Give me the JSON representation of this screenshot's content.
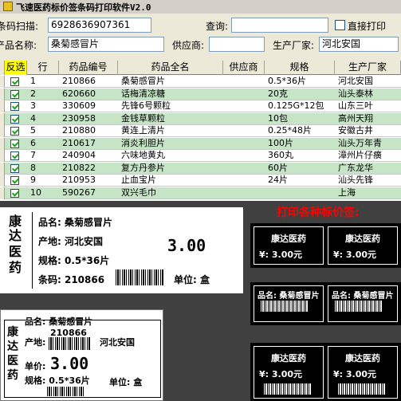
{
  "window": {
    "title": "飞速医药标价签条码打印软件V2.0"
  },
  "form": {
    "barcode_label": "条码扫描:",
    "barcode_value": "6928636907361",
    "query_label": "查询:",
    "query_value": "",
    "print_label": "直接打印",
    "product_label": "产品名称:",
    "product_value": "桑菊感冒片",
    "supplier_label": "供应商:",
    "supplier_value": "",
    "maker_label": "生产厂家:",
    "maker_value": "河北安国"
  },
  "table": {
    "headers": [
      "反选",
      "行",
      "药品编号",
      "药品全名",
      "供应商",
      "规格",
      "生产厂家"
    ],
    "rows": [
      {
        "row": "1",
        "code": "210866",
        "name": "桑菊感冒片",
        "supplier": "",
        "spec": "0.5*36片",
        "maker": "河北安国"
      },
      {
        "row": "2",
        "code": "620660",
        "name": "话梅清凉糖",
        "supplier": "",
        "spec": "20克",
        "maker": "汕头泰林"
      },
      {
        "row": "3",
        "code": "330609",
        "name": "先锋6号颗粒",
        "supplier": "",
        "spec": "0.125G*12包",
        "maker": "山东三叶"
      },
      {
        "row": "4",
        "code": "230958",
        "name": "金钱草颗粒",
        "supplier": "",
        "spec": "10包",
        "maker": "高州天翔"
      },
      {
        "row": "5",
        "code": "210880",
        "name": "黄连上清片",
        "supplier": "",
        "spec": "0.25*48片",
        "maker": "安徽古井"
      },
      {
        "row": "6",
        "code": "210617",
        "name": "消炎利胆片",
        "supplier": "",
        "spec": "100片",
        "maker": "汕头万年青"
      },
      {
        "row": "7",
        "code": "240904",
        "name": "六味地黄丸",
        "supplier": "",
        "spec": "360丸",
        "maker": "漳州片仔癀"
      },
      {
        "row": "8",
        "code": "210822",
        "name": "复方丹参片",
        "supplier": "",
        "spec": "60片",
        "maker": "广东龙华"
      },
      {
        "row": "9",
        "code": "210953",
        "name": "止血宝片",
        "supplier": "",
        "spec": "24片",
        "maker": "汕头先锋"
      },
      {
        "row": "10",
        "code": "590267",
        "name": "双兴毛巾",
        "supplier": "",
        "spec": "",
        "maker": "上海"
      }
    ]
  },
  "labels": {
    "banner": "打印各种标价签:",
    "card1": {
      "brand_chars": [
        "康",
        "达",
        "医",
        "药"
      ],
      "name_line": "品名: 桑菊感冒片",
      "origin_line": "产地: 河北安国",
      "price": "3.00",
      "spec_line": "规格: 0.5*36片",
      "barcode_line": "条码: 210866",
      "unit_line": "单位: 盒"
    },
    "card2": {
      "brand_chars": [
        "康",
        "达",
        "医",
        "药"
      ],
      "name_line": "品名: 桑菊感冒片",
      "code": "210866",
      "origin_label": "产地:",
      "origin_value": "河北安国",
      "price_label": "单价:",
      "price": "3.00",
      "spec_line": "规格: 0.5*36片",
      "unit_line": "单位: 盒"
    },
    "small_brand": "康达医药",
    "small_price": "¥: 3.00元",
    "small_name": "品名: 桑菊感冒片"
  }
}
